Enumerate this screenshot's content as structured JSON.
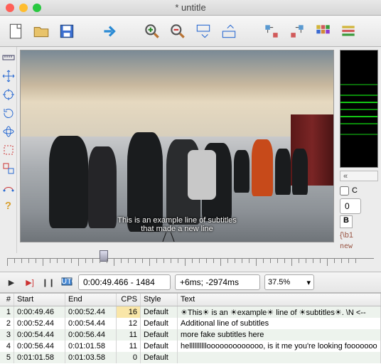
{
  "window": {
    "title": "* untitle"
  },
  "traffic": {
    "close": "#ff5f57",
    "min": "#ffbd2e",
    "max": "#28c840"
  },
  "subtitle_overlay": {
    "line1": "This is an example line of subtitles",
    "line2": "that made a new line"
  },
  "controls": {
    "timecode": "0:00:49.466 - 1484",
    "offset": "+6ms; -2974ms",
    "zoom": "37.5%"
  },
  "side": {
    "checkbox_label": "C",
    "number": "0",
    "bold": "B",
    "escaped": "{\\b1",
    "line2": "new"
  },
  "headers": {
    "num": "#",
    "start": "Start",
    "end": "End",
    "cps": "CPS",
    "style": "Style",
    "text": "Text"
  },
  "rows": [
    {
      "n": "1",
      "start": "0:00:49.46",
      "end": "0:00:52.44",
      "cps": "16",
      "style": "Default",
      "text": "☀This☀ is an ☀example☀ line of ☀subtitles☀. \\N <--"
    },
    {
      "n": "2",
      "start": "0:00:52.44",
      "end": "0:00:54.44",
      "cps": "12",
      "style": "Default",
      "text": "Additional line of subtitles"
    },
    {
      "n": "3",
      "start": "0:00:54.44",
      "end": "0:00:56.44",
      "cps": "11",
      "style": "Default",
      "text": "more fake subtitles here"
    },
    {
      "n": "4",
      "start": "0:00:56.44",
      "end": "0:01:01.58",
      "cps": "11",
      "style": "Default",
      "text": "hellllllllllooooooooooooo, is it me you're looking fooooooo"
    },
    {
      "n": "5",
      "start": "0:01:01.58",
      "end": "0:01:03.58",
      "cps": "0",
      "style": "Default",
      "text": ""
    }
  ]
}
